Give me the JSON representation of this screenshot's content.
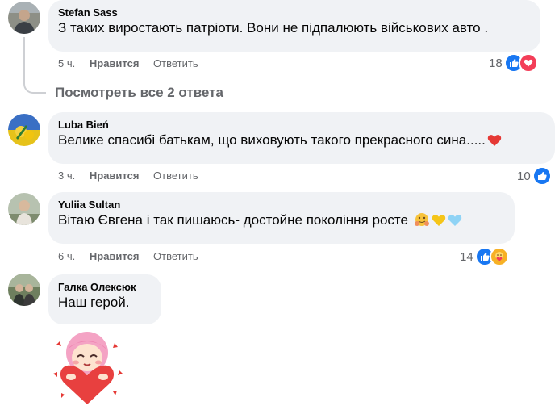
{
  "comments": [
    {
      "author": "Stefan Sass",
      "text": "З таких виростають патріоти. Вони не підпалюють військових авто .",
      "time": "5 ч.",
      "like_label": "Нравится",
      "reply_label": "Ответить",
      "reaction_count": "18",
      "reactions": [
        "like-icon",
        "love-icon"
      ]
    },
    {
      "author": "Luba Bień",
      "text": "Велике спасибі батькам, що виховують такого прекрасного сина.....",
      "text_emoji": "heart",
      "time": "3 ч.",
      "like_label": "Нравится",
      "reply_label": "Ответить",
      "reaction_count": "10",
      "reactions": [
        "like-icon"
      ]
    },
    {
      "author": "Yuliia Sultan",
      "text": "Вітаю Євгена і так пишаюсь- достойне покоління росте",
      "text_emoji": [
        "hugging-face",
        "yellow-heart",
        "blue-heart"
      ],
      "time": "6 ч.",
      "like_label": "Нравится",
      "reply_label": "Ответить",
      "reaction_count": "14",
      "reactions": [
        "like-icon",
        "care-icon"
      ]
    },
    {
      "author": "Галка Олексюк",
      "text": "Наш герой.",
      "sticker": "girl-holding-heart-sticker"
    }
  ],
  "view_replies_label": "Посмотреть все 2 ответа",
  "colors": {
    "bubble": "#f0f2f5",
    "meta": "#65676b",
    "like": "#1877f2",
    "love": "#f33e58"
  }
}
